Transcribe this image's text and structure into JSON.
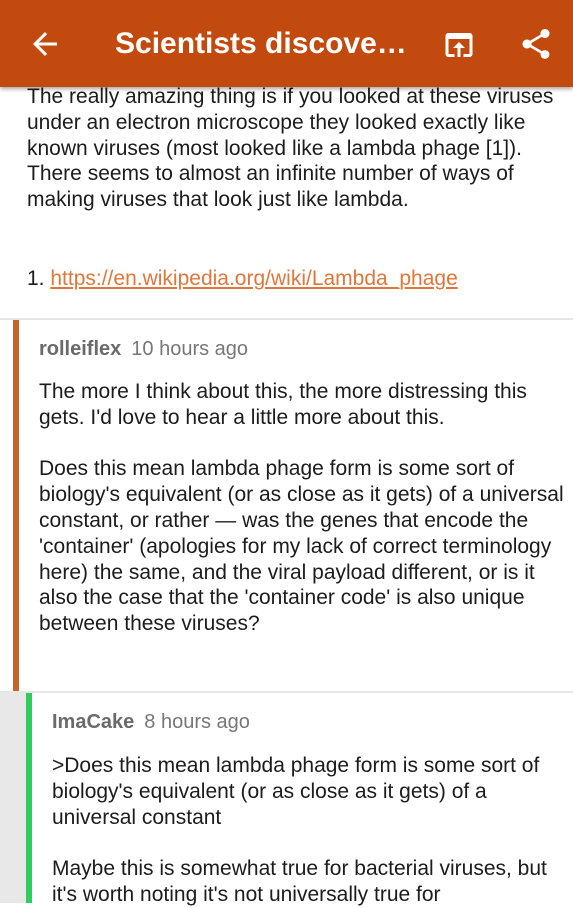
{
  "appbar": {
    "title": "Scientists discover Hundreds of New Viruses",
    "icons": {
      "back": "arrow-back-icon",
      "open": "open-in-browser-icon",
      "share": "share-icon"
    },
    "bg_color": "#c24a0f"
  },
  "post": {
    "body": "The really amazing thing is if you looked at these viruses under an electron microscope they looked exactly like known viruses (most looked like a lambda phage [1]). There seems to almost an infinite number of ways of making viruses that look just like lambda.",
    "ref_number": "1.",
    "ref_link": "https://en.wikipedia.org/wiki/Lambda_phage",
    "link_color": "#e0773a"
  },
  "comments": [
    {
      "user": "rolleiflex",
      "time": "10 hours ago",
      "body": "The more I think about this, the more distressing this gets. I'd love to hear a little more about this.\n\nDoes this mean lambda phage form is some sort of biology's equivalent (or as close as it gets) of a universal constant, or rather — was the genes that encode the 'container' (apologies for my lack of correct terminology here) the same, and the viral payload different, or is it also the case that the 'container code' is also unique between these viruses?",
      "bar_color": "#c8632a"
    },
    {
      "user": "ImaCake",
      "time": "8 hours ago",
      "body": ">Does this mean lambda phage form is some sort of biology's equivalent (or as close as it gets) of a universal constant\n\nMaybe this is somewhat true for bacterial viruses, but it's worth noting it's not universally true for",
      "bar_color": "#2ecc5a"
    }
  ]
}
